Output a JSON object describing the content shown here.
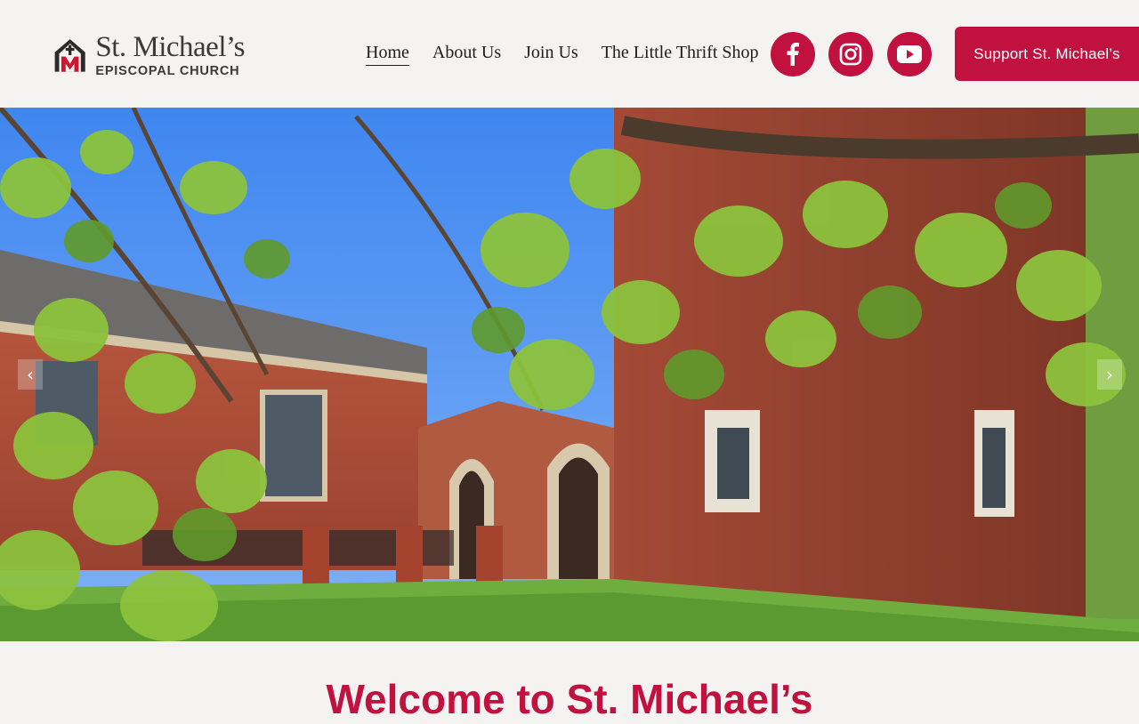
{
  "logo": {
    "name": "St. Michael’s",
    "subtitle": "EPISCOPAL CHURCH"
  },
  "nav": {
    "items": [
      {
        "label": "Home",
        "active": true
      },
      {
        "label": "About Us"
      },
      {
        "label": "Join Us"
      },
      {
        "label": "The Little Thrift Shop"
      }
    ]
  },
  "social": {
    "icons": [
      "facebook-icon",
      "instagram-icon",
      "youtube-icon"
    ]
  },
  "support_button": {
    "label": "Support St. Michael’s"
  },
  "hero": {
    "prev_arrow": "‹",
    "next_arrow": "›"
  },
  "welcome": {
    "heading": "Welcome to St. Michael’s"
  },
  "colors": {
    "accent": "#c1123f",
    "background": "#f4f3f2"
  }
}
